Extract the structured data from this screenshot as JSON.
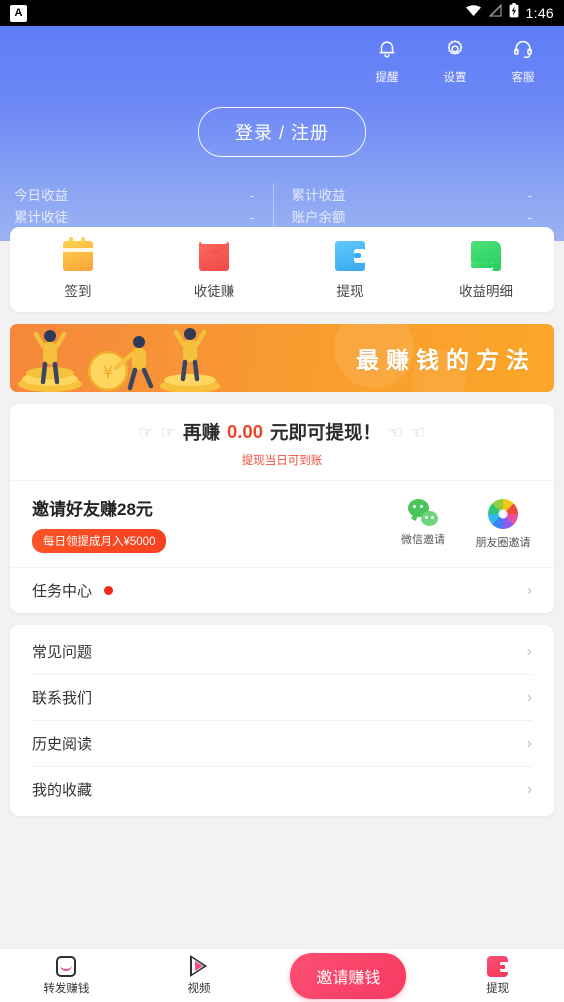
{
  "status_bar": {
    "app_icon": "A",
    "icons": [
      "wifi-icon",
      "signal-off-icon",
      "battery-icon"
    ],
    "time": "1:46"
  },
  "header": {
    "actions": [
      {
        "icon": "bell-icon",
        "label": "提醒"
      },
      {
        "icon": "gear-icon",
        "label": "设置"
      },
      {
        "icon": "headset-icon",
        "label": "客服"
      }
    ],
    "login_label": "登录 / 注册",
    "gradient_from": "#5f7df6",
    "gradient_to": "#9cb2f2",
    "stats": [
      {
        "label": "今日收益",
        "value": "-"
      },
      {
        "label": "累计收益",
        "value": "-"
      },
      {
        "label": "累计收徒",
        "value": "-"
      },
      {
        "label": "账户余额",
        "value": "-"
      }
    ]
  },
  "quick_actions": [
    {
      "icon": "calendar-icon",
      "label": "签到"
    },
    {
      "icon": "red-envelope-icon",
      "label": "收徒赚"
    },
    {
      "icon": "wallet-icon",
      "label": "提现"
    },
    {
      "icon": "ledger-icon",
      "label": "收益明细"
    }
  ],
  "banner": {
    "title": "最赚钱的方法",
    "bg_color": "#f79338"
  },
  "promo": {
    "headline_prefix": "再赚",
    "headline_amount": "0.00",
    "headline_suffix": "元即可提现！",
    "subtitle": "提现当日可到账",
    "amount_color": "#e8492b",
    "invite_title": "邀请好友赚28元",
    "invite_badge": "每日领提成月入¥5000",
    "share": [
      {
        "icon": "wechat-icon",
        "label": "微信邀请"
      },
      {
        "icon": "moments-icon",
        "label": "朋友圈邀请"
      }
    ],
    "task_center": {
      "label": "任务中心",
      "badge_color": "#f02b16"
    }
  },
  "menu": {
    "items": [
      {
        "label": "常见问题"
      },
      {
        "label": "联系我们"
      },
      {
        "label": "历史阅读"
      },
      {
        "label": "我的收藏"
      }
    ]
  },
  "bottom_nav": {
    "items": [
      {
        "icon": "forward-earn-icon",
        "label": "转发赚钱"
      },
      {
        "icon": "video-icon",
        "label": "视频"
      }
    ],
    "cta_label": "邀请赚钱",
    "withdraw": {
      "icon": "withdraw-icon",
      "label": "提现"
    },
    "accent_color": "#f73a62"
  }
}
